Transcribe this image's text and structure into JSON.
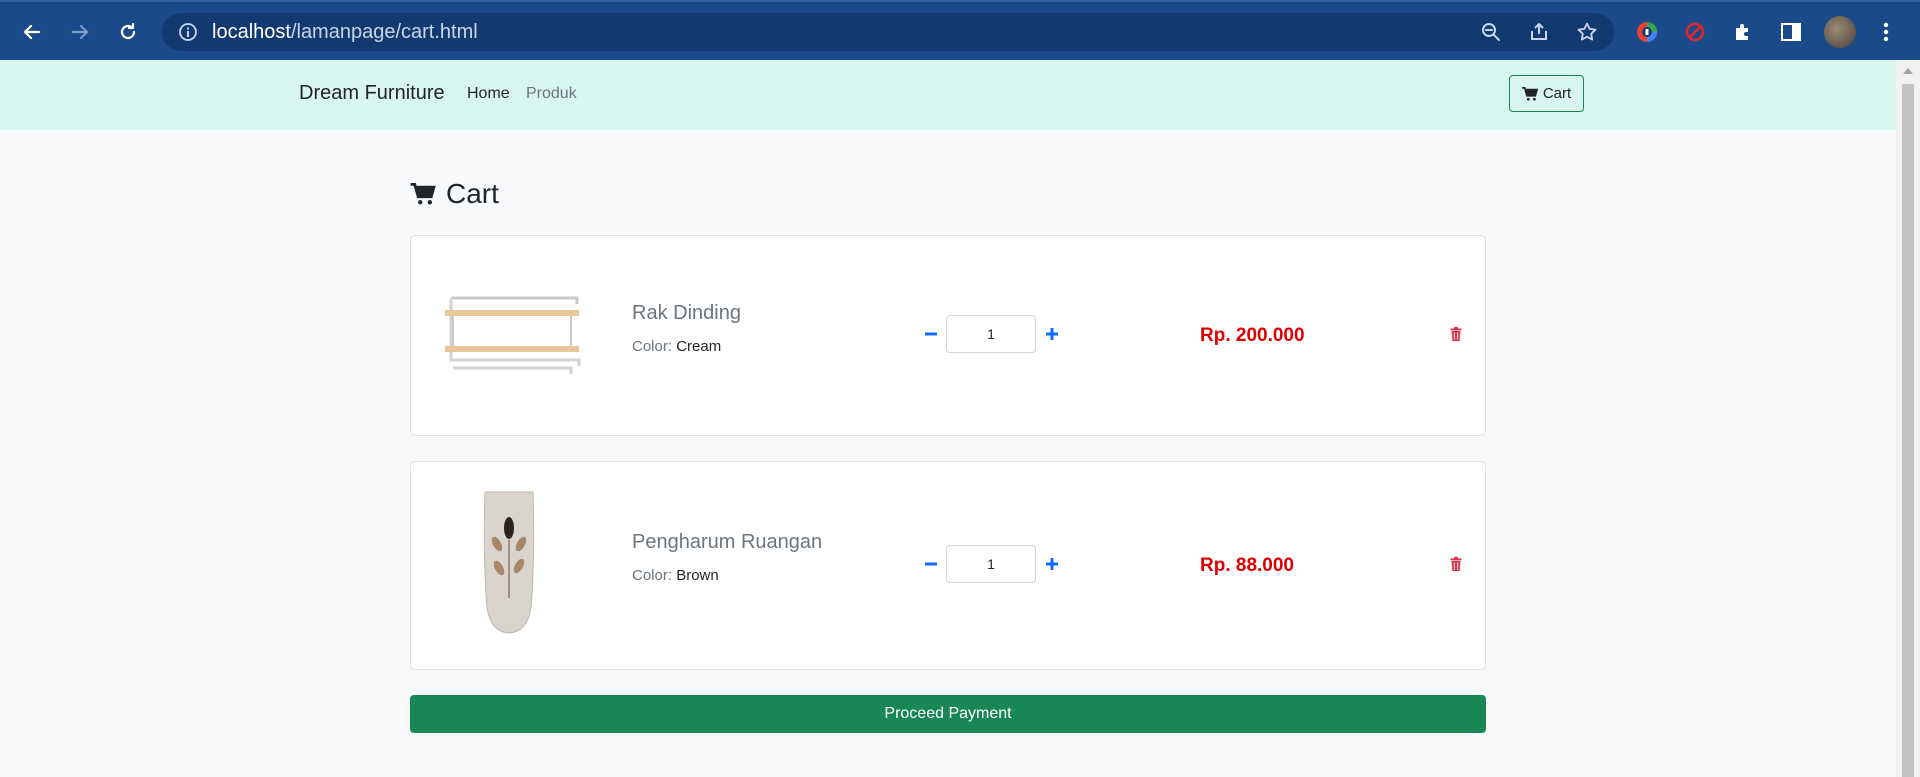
{
  "browser": {
    "url_host": "localhost",
    "url_path": "/lamanpage/cart.html"
  },
  "navbar": {
    "brand": "Dream Furniture",
    "links": [
      "Home",
      "Produk"
    ],
    "cart_label": "Cart"
  },
  "page": {
    "title": "Cart"
  },
  "cart": {
    "color_label": "Color:",
    "items": [
      {
        "name": "Rak Dinding",
        "color": "Cream",
        "quantity": "1",
        "price": "Rp. 200.000"
      },
      {
        "name": "Pengharum Ruangan",
        "color": "Brown",
        "quantity": "1",
        "price": "Rp. 88.000"
      }
    ],
    "proceed_label": "Proceed Payment"
  },
  "colors": {
    "navbar_bg": "#d9f5f0",
    "accent_green": "#198754",
    "price_red": "#e00000",
    "qty_blue": "#0d6efd",
    "trash_red": "#dc3545",
    "browser_bar": "#1a4a8a"
  },
  "icons": {
    "browser": [
      "back-icon",
      "forward-icon",
      "reload-icon",
      "info-icon",
      "zoom-icon",
      "share-icon",
      "star-icon",
      "extension-icon",
      "puzzle-icon",
      "sidepanel-icon",
      "avatar",
      "menu-icon"
    ],
    "page": [
      "cart-icon",
      "minus-icon",
      "plus-icon",
      "trash-icon"
    ]
  }
}
